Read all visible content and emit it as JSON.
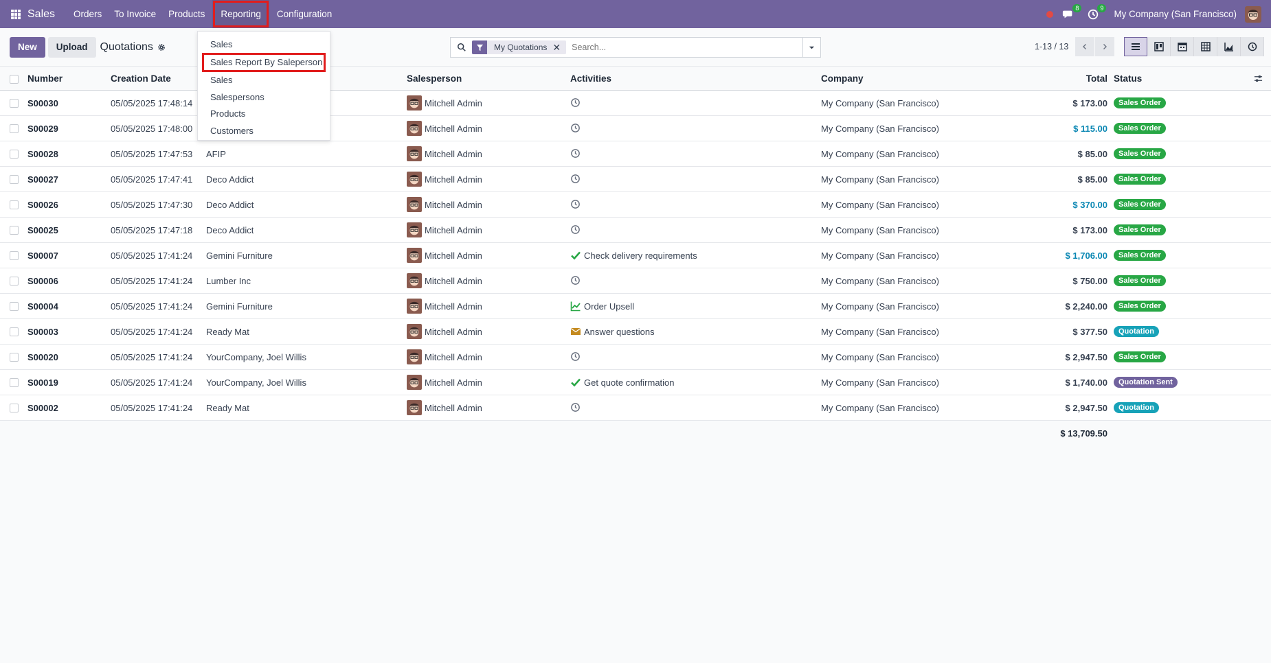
{
  "navbar": {
    "brand": "Sales",
    "menu": [
      "Orders",
      "To Invoice",
      "Products",
      "Reporting",
      "Configuration"
    ],
    "messages_badge": "8",
    "activities_badge": "9",
    "company": "My Company (San Francisco)"
  },
  "reporting_menu": {
    "items": [
      "Sales",
      "Sales Report By Saleperson",
      "Sales",
      "Salespersons",
      "Products",
      "Customers"
    ]
  },
  "control": {
    "new_label": "New",
    "upload_label": "Upload",
    "breadcrumb": "Quotations",
    "facet_label": "My Quotations",
    "facet_remove": "✕",
    "search_placeholder": "Search...",
    "pager": "1-13 / 13"
  },
  "table": {
    "headers": {
      "number": "Number",
      "date": "Creation Date",
      "salesperson": "Salesperson",
      "activities": "Activities",
      "company": "Company",
      "total": "Total",
      "status": "Status"
    },
    "rows": [
      {
        "number": "S00030",
        "date": "05/05/2025 17:48:14",
        "customer": "",
        "salesperson": "Mitchell Admin",
        "activity": "",
        "activity_icon": "clock-icon",
        "company": "My Company (San Francisco)",
        "total": "$ 173.00",
        "total_color": "dark",
        "status": "Sales Order",
        "status_color": "green"
      },
      {
        "number": "S00029",
        "date": "05/05/2025 17:48:00",
        "customer": "",
        "salesperson": "Mitchell Admin",
        "activity": "",
        "activity_icon": "clock-icon",
        "company": "My Company (San Francisco)",
        "total": "$ 115.00",
        "total_color": "blue",
        "status": "Sales Order",
        "status_color": "green"
      },
      {
        "number": "S00028",
        "date": "05/05/2025 17:47:53",
        "customer": "AFIP",
        "salesperson": "Mitchell Admin",
        "activity": "",
        "activity_icon": "clock-icon",
        "company": "My Company (San Francisco)",
        "total": "$ 85.00",
        "total_color": "dark",
        "status": "Sales Order",
        "status_color": "green"
      },
      {
        "number": "S00027",
        "date": "05/05/2025 17:47:41",
        "customer": "Deco Addict",
        "salesperson": "Mitchell Admin",
        "activity": "",
        "activity_icon": "clock-icon",
        "company": "My Company (San Francisco)",
        "total": "$ 85.00",
        "total_color": "dark",
        "status": "Sales Order",
        "status_color": "green"
      },
      {
        "number": "S00026",
        "date": "05/05/2025 17:47:30",
        "customer": "Deco Addict",
        "salesperson": "Mitchell Admin",
        "activity": "",
        "activity_icon": "clock-icon",
        "company": "My Company (San Francisco)",
        "total": "$ 370.00",
        "total_color": "blue",
        "status": "Sales Order",
        "status_color": "green"
      },
      {
        "number": "S00025",
        "date": "05/05/2025 17:47:18",
        "customer": "Deco Addict",
        "salesperson": "Mitchell Admin",
        "activity": "",
        "activity_icon": "clock-icon",
        "company": "My Company (San Francisco)",
        "total": "$ 173.00",
        "total_color": "dark",
        "status": "Sales Order",
        "status_color": "green"
      },
      {
        "number": "S00007",
        "date": "05/05/2025 17:41:24",
        "customer": "Gemini Furniture",
        "salesperson": "Mitchell Admin",
        "activity": "Check delivery requirements",
        "activity_icon": "check-icon",
        "company": "My Company (San Francisco)",
        "total": "$ 1,706.00",
        "total_color": "blue",
        "status": "Sales Order",
        "status_color": "green"
      },
      {
        "number": "S00006",
        "date": "05/05/2025 17:41:24",
        "customer": "Lumber Inc",
        "salesperson": "Mitchell Admin",
        "activity": "",
        "activity_icon": "clock-icon",
        "company": "My Company (San Francisco)",
        "total": "$ 750.00",
        "total_color": "dark",
        "status": "Sales Order",
        "status_color": "green"
      },
      {
        "number": "S00004",
        "date": "05/05/2025 17:41:24",
        "customer": "Gemini Furniture",
        "salesperson": "Mitchell Admin",
        "activity": "Order Upsell",
        "activity_icon": "chart-line-icon",
        "company": "My Company (San Francisco)",
        "total": "$ 2,240.00",
        "total_color": "dark",
        "status": "Sales Order",
        "status_color": "green"
      },
      {
        "number": "S00003",
        "date": "05/05/2025 17:41:24",
        "customer": "Ready Mat",
        "salesperson": "Mitchell Admin",
        "activity": "Answer questions",
        "activity_icon": "envelope-icon",
        "company": "My Company (San Francisco)",
        "total": "$ 377.50",
        "total_color": "dark",
        "status": "Quotation",
        "status_color": "cyan"
      },
      {
        "number": "S00020",
        "date": "05/05/2025 17:41:24",
        "customer": "YourCompany, Joel Willis",
        "salesperson": "Mitchell Admin",
        "activity": "",
        "activity_icon": "clock-icon",
        "company": "My Company (San Francisco)",
        "total": "$ 2,947.50",
        "total_color": "dark",
        "status": "Sales Order",
        "status_color": "green"
      },
      {
        "number": "S00019",
        "date": "05/05/2025 17:41:24",
        "customer": "YourCompany, Joel Willis",
        "salesperson": "Mitchell Admin",
        "activity": "Get quote confirmation",
        "activity_icon": "check-icon",
        "company": "My Company (San Francisco)",
        "total": "$ 1,740.00",
        "total_color": "dark",
        "status": "Quotation Sent",
        "status_color": "purple"
      },
      {
        "number": "S00002",
        "date": "05/05/2025 17:41:24",
        "customer": "Ready Mat",
        "salesperson": "Mitchell Admin",
        "activity": "",
        "activity_icon": "clock-icon",
        "company": "My Company (San Francisco)",
        "total": "$ 2,947.50",
        "total_color": "dark",
        "status": "Quotation",
        "status_color": "cyan"
      }
    ],
    "sum_total": "$ 13,709.50"
  },
  "colors": {
    "brand": "#71639e",
    "highlight": "#e11d1d",
    "status_green": "#28a745",
    "status_cyan": "#17a2b8",
    "total_blue": "#0a87b3"
  }
}
